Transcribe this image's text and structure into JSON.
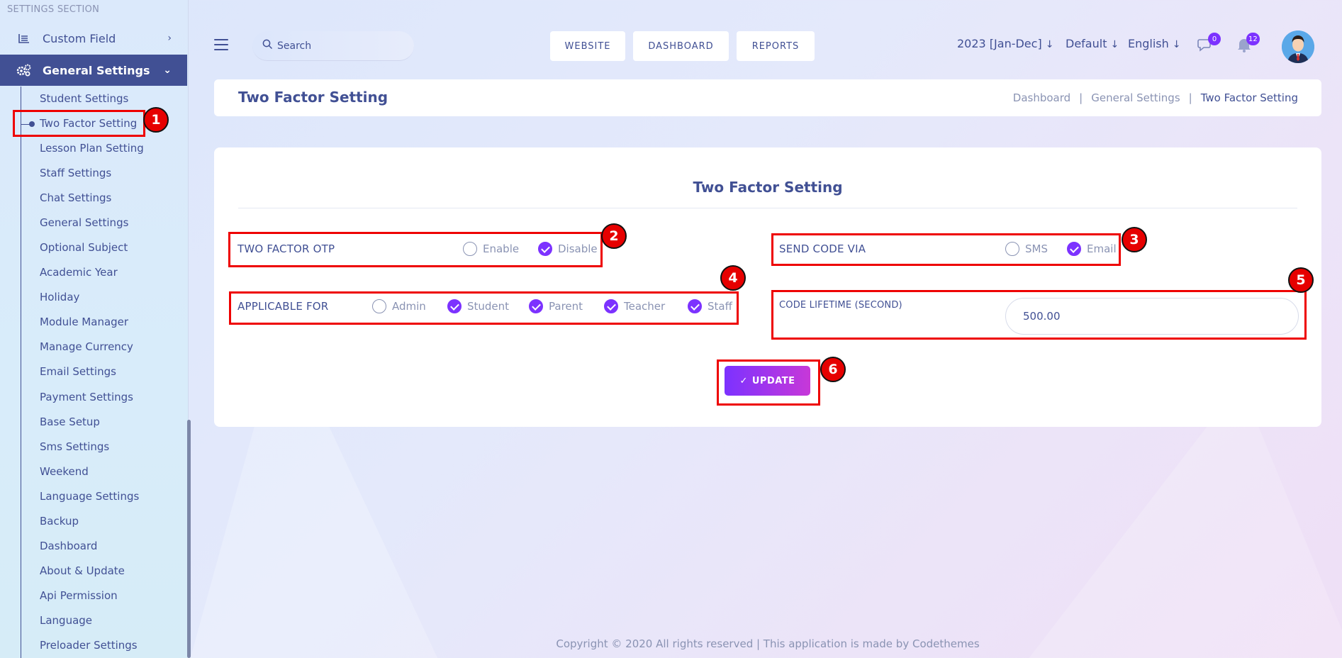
{
  "sidebar": {
    "section_title": "SETTINGS SECTION",
    "custom_field": "Custom Field",
    "general_settings": "General Settings",
    "items": [
      "Student Settings",
      "Two Factor Setting",
      "Lesson Plan Setting",
      "Staff Settings",
      "Chat Settings",
      "General Settings",
      "Optional Subject",
      "Academic Year",
      "Holiday",
      "Module Manager",
      "Manage Currency",
      "Email Settings",
      "Payment Settings",
      "Base Setup",
      "Sms Settings",
      "Weekend",
      "Language Settings",
      "Backup",
      "Dashboard",
      "About & Update",
      "Api Permission",
      "Language",
      "Preloader Settings"
    ],
    "active_item": "Two Factor Setting"
  },
  "topbar": {
    "search_placeholder": "Search",
    "buttons": {
      "website": "WEBSITE",
      "dashboard": "DASHBOARD",
      "reports": "REPORTS"
    },
    "academic_year": "2023 [Jan-Dec]",
    "style": "Default",
    "language": "English",
    "chat_count": "0",
    "notification_count": "12"
  },
  "header": {
    "title": "Two Factor Setting",
    "breadcrumb": [
      "Dashboard",
      "General Settings",
      "Two Factor Setting"
    ]
  },
  "form": {
    "title": "Two Factor Setting",
    "two_factor_otp": {
      "label": "TWO FACTOR OTP",
      "options": [
        {
          "label": "Enable",
          "checked": false
        },
        {
          "label": "Disable",
          "checked": true
        }
      ]
    },
    "send_code_via": {
      "label": "SEND CODE VIA",
      "options": [
        {
          "label": "SMS",
          "checked": false
        },
        {
          "label": "Email",
          "checked": true
        }
      ]
    },
    "applicable_for": {
      "label": "APPLICABLE FOR",
      "options": [
        {
          "label": "Admin",
          "checked": false
        },
        {
          "label": "Student",
          "checked": true
        },
        {
          "label": "Parent",
          "checked": true
        },
        {
          "label": "Teacher",
          "checked": true
        },
        {
          "label": "Staff",
          "checked": true
        }
      ]
    },
    "code_lifetime": {
      "label": "CODE LIFETIME (SECOND)",
      "value": "500.00"
    },
    "update_label": "UPDATE"
  },
  "annotations": [
    "1",
    "2",
    "3",
    "4",
    "5",
    "6"
  ],
  "colors": {
    "primary": "#415094",
    "accent": "#7c32ff",
    "highlight": "#ee0000"
  },
  "footer": "Copyright © 2020 All rights reserved | This application is made by Codethemes"
}
